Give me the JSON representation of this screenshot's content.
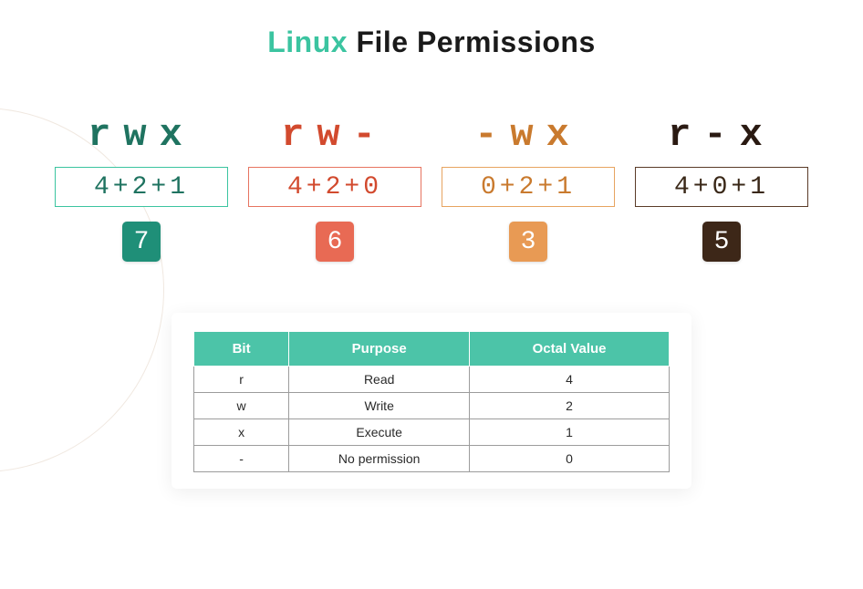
{
  "title": {
    "accent": "Linux",
    "rest": " File Permissions"
  },
  "columns": [
    {
      "letters": "rwx",
      "sum": "4+2+1",
      "octal": "7"
    },
    {
      "letters": "rw-",
      "sum": "4+2+0",
      "octal": "6"
    },
    {
      "letters": "-wx",
      "sum": "0+2+1",
      "octal": "3"
    },
    {
      "letters": "r-x",
      "sum": "4+0+1",
      "octal": "5"
    }
  ],
  "table": {
    "headers": {
      "bit": "Bit",
      "purpose": "Purpose",
      "octal": "Octal Value"
    },
    "rows": [
      {
        "bit": "r",
        "purpose": "Read",
        "octal": "4"
      },
      {
        "bit": "w",
        "purpose": "Write",
        "octal": "2"
      },
      {
        "bit": "x",
        "purpose": "Execute",
        "octal": "1"
      },
      {
        "bit": "-",
        "purpose": "No permission",
        "octal": "0"
      }
    ]
  },
  "chart_data": {
    "type": "table",
    "title": "Linux File Permissions",
    "permission_triplets": [
      {
        "symbol": "rwx",
        "expression": "4+2+1",
        "octal": 7
      },
      {
        "symbol": "rw-",
        "expression": "4+2+0",
        "octal": 6
      },
      {
        "symbol": "-wx",
        "expression": "0+2+1",
        "octal": 3
      },
      {
        "symbol": "r-x",
        "expression": "4+0+1",
        "octal": 5
      }
    ],
    "bit_reference": [
      {
        "bit": "r",
        "purpose": "Read",
        "octal_value": 4
      },
      {
        "bit": "w",
        "purpose": "Write",
        "octal_value": 2
      },
      {
        "bit": "x",
        "purpose": "Execute",
        "octal_value": 1
      },
      {
        "bit": "-",
        "purpose": "No permission",
        "octal_value": 0
      }
    ]
  }
}
